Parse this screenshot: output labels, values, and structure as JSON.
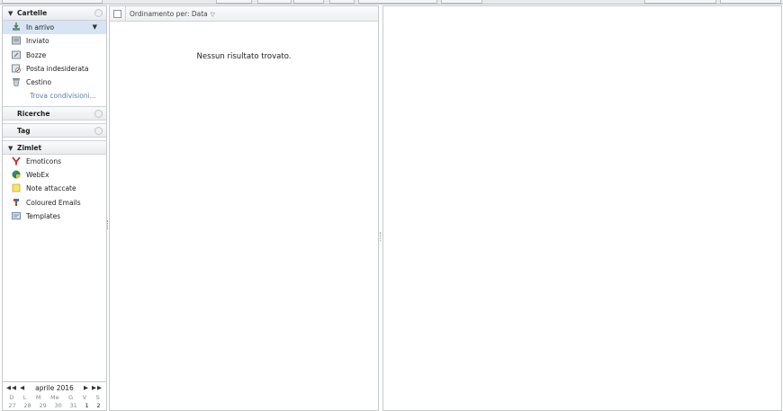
{
  "folders": {
    "header": "Cartelle",
    "items": [
      {
        "label": "In arrivo",
        "icon": "inbox-icon",
        "selected": true
      },
      {
        "label": "Inviato",
        "icon": "sent-icon"
      },
      {
        "label": "Bozze",
        "icon": "drafts-icon"
      },
      {
        "label": "Posta indesiderata",
        "icon": "junk-icon"
      },
      {
        "label": "Cestino",
        "icon": "trash-icon"
      }
    ],
    "find_shares": "Trova condivisioni..."
  },
  "searches": {
    "header": "Ricerche"
  },
  "tags": {
    "header": "Tag"
  },
  "zimlets": {
    "header": "Zimlet",
    "items": [
      {
        "label": "Emoticons",
        "icon": "yahoo-y-icon"
      },
      {
        "label": "WebEx",
        "icon": "globe-icon"
      },
      {
        "label": "Note attaccate",
        "icon": "sticky-note-icon"
      },
      {
        "label": "Coloured Emails",
        "icon": "paint-icon"
      },
      {
        "label": "Templates",
        "icon": "template-icon"
      }
    ]
  },
  "calendar": {
    "month": "aprile 2016",
    "nav_prev": "◀◀ ◀",
    "nav_next": "▶ ▶▶",
    "weekdays": [
      "D",
      "L",
      "M",
      "Me",
      "G",
      "V",
      "S"
    ],
    "first_week": [
      "27",
      "28",
      "29",
      "30",
      "31",
      "1",
      "2"
    ]
  },
  "message_list": {
    "sort_label": "Ordinamento per: Data",
    "empty_text": "Nessun risultato trovato."
  },
  "colors": {
    "selected_bg": "#d6e4f3",
    "link": "#5a7bad",
    "border": "#c4c8cc"
  }
}
